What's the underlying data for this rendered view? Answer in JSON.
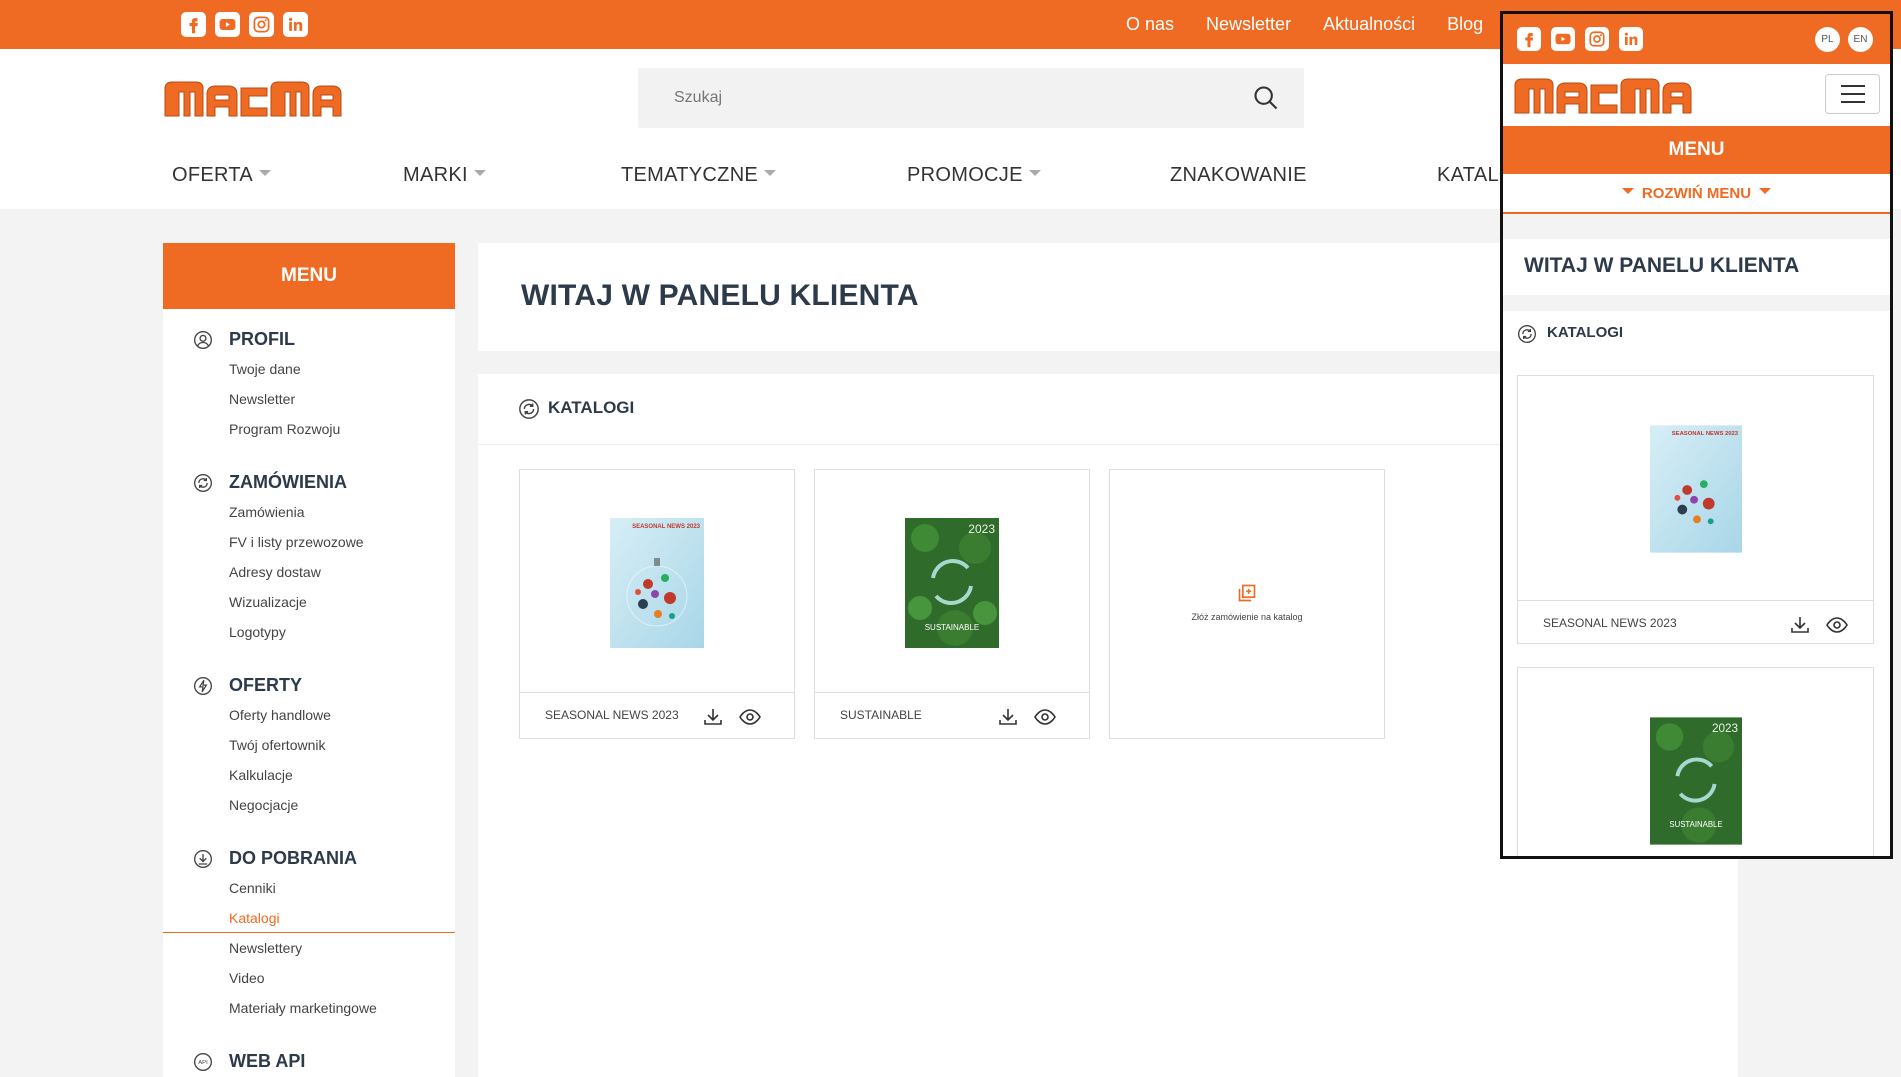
{
  "colors": {
    "brand": "#ef6a22",
    "title": "#2d3a4a"
  },
  "topbar": {
    "social": [
      "facebook-icon",
      "youtube-icon",
      "instagram-icon",
      "linkedin-icon"
    ],
    "links": [
      "O nas",
      "Newsletter",
      "Aktualności",
      "Blog"
    ]
  },
  "search": {
    "placeholder": "Szukaj"
  },
  "nav": [
    {
      "label": "OFERTA",
      "dropdown": true
    },
    {
      "label": "MARKI",
      "dropdown": true
    },
    {
      "label": "TEMATYCZNE",
      "dropdown": true
    },
    {
      "label": "PROMOCJE",
      "dropdown": true
    },
    {
      "label": "ZNAKOWANIE",
      "dropdown": false
    },
    {
      "label": "KATALO",
      "dropdown": false
    }
  ],
  "sidebar": {
    "title": "MENU",
    "sections": [
      {
        "title": "PROFIL",
        "icon": "user-icon",
        "items": [
          "Twoje dane",
          "Newsletter",
          "Program Rozwoju"
        ]
      },
      {
        "title": "ZAMÓWIENIA",
        "icon": "refresh-icon",
        "items": [
          "Zamówienia",
          "FV i listy przewozowe",
          "Adresy dostaw",
          "Wizualizacje",
          "Logotypy"
        ]
      },
      {
        "title": "OFERTY",
        "icon": "bolt-icon",
        "items": [
          "Oferty handlowe",
          "Twój ofertownik",
          "Kalkulacje",
          "Negocjacje"
        ]
      },
      {
        "title": "DO POBRANIA",
        "icon": "download-icon",
        "items": [
          "Cenniki",
          "Katalogi",
          "Newslettery",
          "Video",
          "Materiały marketingowe"
        ],
        "active": "Katalogi"
      },
      {
        "title": "WEB API",
        "icon": "api-icon",
        "items": []
      }
    ]
  },
  "main": {
    "title": "WITAJ W PANELU KLIENTA",
    "section_title": "KATALOGI",
    "catalogs": [
      {
        "name": "SEASONAL NEWS 2023",
        "cover_text": "SEASONAL NEWS 2023"
      },
      {
        "name": "SUSTAINABLE",
        "cover_text": "2023",
        "cover_sub": "SUSTAINABLE"
      }
    ],
    "order_label": "Złóż zamówienie na katalog"
  },
  "mobile": {
    "langs": [
      "PL",
      "EN"
    ],
    "menu_label": "MENU",
    "expand_label": "ROZWIŃ MENU",
    "title": "WITAJ W PANELU KLIENTA",
    "section_title": "KATALOGI",
    "catalog_name": "SEASONAL NEWS 2023"
  }
}
